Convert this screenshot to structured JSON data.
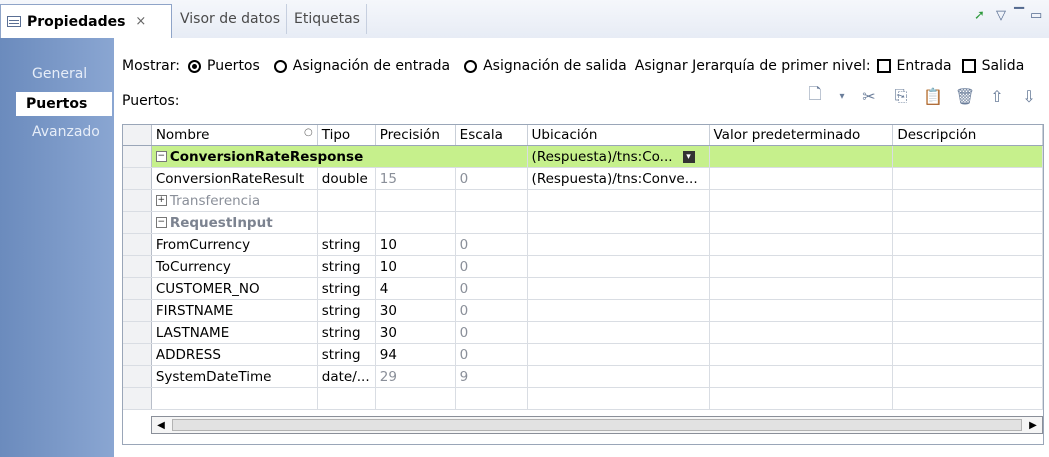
{
  "tabs": [
    {
      "label": "Propiedades",
      "close": "×"
    },
    {
      "label": "Visor de datos"
    },
    {
      "label": "Etiquetas"
    }
  ],
  "nav": [
    "General",
    "Puertos",
    "Avanzado"
  ],
  "show": {
    "label": "Mostrar:",
    "opt1": "Puertos",
    "opt2": "Asignación de entrada",
    "opt3": "Asignación de salida",
    "hier_label": "Asignar Jerarquía de primer nivel:",
    "in": "Entrada",
    "out": "Salida"
  },
  "ports_label": "Puertos:",
  "table": {
    "headers": [
      "Nombre",
      "Tipo",
      "Precisión",
      "Escala",
      "Ubicación",
      "Valor predeterminado",
      "Descripción"
    ],
    "rows": [
      {
        "name": "ConversionRateResponse",
        "type": "",
        "prec": "",
        "scale": "",
        "loc": "(Respuesta)/tns:Co..."
      },
      {
        "name": "ConversionRateResult",
        "type": "double",
        "prec": "15",
        "scale": "0",
        "loc": "(Respuesta)/tns:Conve..."
      },
      {
        "name": "Transferencia",
        "type": "",
        "prec": "",
        "scale": "",
        "loc": ""
      },
      {
        "name": "RequestInput",
        "type": "",
        "prec": "",
        "scale": "",
        "loc": ""
      },
      {
        "name": "FromCurrency",
        "type": "string",
        "prec": "10",
        "scale": "0",
        "loc": ""
      },
      {
        "name": "ToCurrency",
        "type": "string",
        "prec": "10",
        "scale": "0",
        "loc": ""
      },
      {
        "name": "CUSTOMER_NO",
        "type": "string",
        "prec": "4",
        "scale": "0",
        "loc": ""
      },
      {
        "name": "FIRSTNAME",
        "type": "string",
        "prec": "30",
        "scale": "0",
        "loc": ""
      },
      {
        "name": "LASTNAME",
        "type": "string",
        "prec": "30",
        "scale": "0",
        "loc": ""
      },
      {
        "name": "ADDRESS",
        "type": "string",
        "prec": "94",
        "scale": "0",
        "loc": ""
      },
      {
        "name": "SystemDateTime",
        "type": "date/...",
        "prec": "29",
        "scale": "9",
        "loc": ""
      }
    ]
  }
}
